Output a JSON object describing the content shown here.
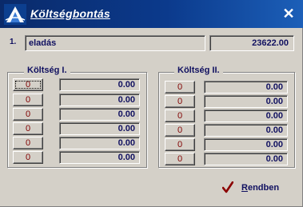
{
  "window": {
    "title": "Költségbontás"
  },
  "header_row": {
    "index": "1.",
    "name": "eladás",
    "total": "23622.00"
  },
  "group_left": {
    "label": "Költség I.",
    "rows": [
      {
        "button": "0",
        "value": "0.00"
      },
      {
        "button": "0",
        "value": "0.00"
      },
      {
        "button": "0",
        "value": "0.00"
      },
      {
        "button": "0",
        "value": "0.00"
      },
      {
        "button": "0",
        "value": "0.00"
      },
      {
        "button": "0",
        "value": "0.00"
      }
    ]
  },
  "group_right": {
    "label": "Költség II.",
    "rows": [
      {
        "button": "0",
        "value": "0.00"
      },
      {
        "button": "0",
        "value": "0.00"
      },
      {
        "button": "0",
        "value": "0.00"
      },
      {
        "button": "0",
        "value": "0.00"
      },
      {
        "button": "0",
        "value": "0.00"
      },
      {
        "button": "0",
        "value": "0.00"
      }
    ]
  },
  "footer": {
    "ok_label_first": "R",
    "ok_label_rest": "endben"
  },
  "colors": {
    "title_bg": "#0b3a8c",
    "text": "#101060",
    "button_text": "#800000",
    "check": "#8b0000"
  }
}
